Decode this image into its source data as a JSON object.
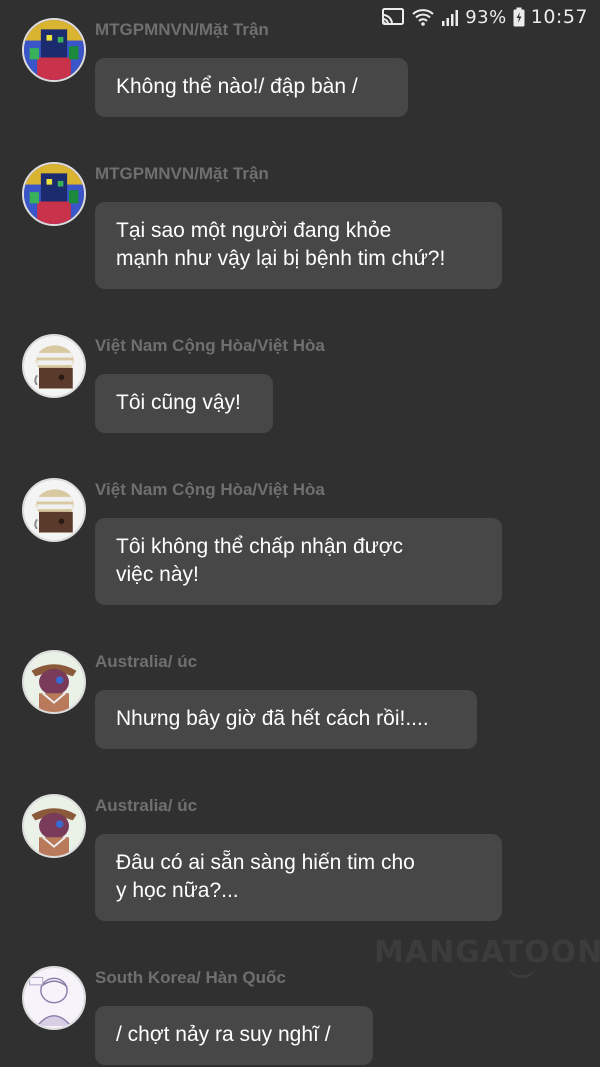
{
  "status_bar": {
    "cast_icon": "screen-cast-icon",
    "wifi_icon": "wifi-icon",
    "signal_icon": "signal-icon",
    "battery_percent": "93%",
    "battery_icon": "battery-charging-icon",
    "time": "10:57"
  },
  "messages": [
    {
      "sender": "MTGPMNVN/Mặt Trận",
      "avatar": "mtgpmnvn-avatar",
      "text": "Không thể nào!/ đập bàn /"
    },
    {
      "sender": "MTGPMNVN/Mặt Trận",
      "avatar": "mtgpmnvn-avatar",
      "text_lines": [
        "Tại sao một người đang khỏe",
        "mạnh như vậy lại bị bệnh tim chứ?!"
      ]
    },
    {
      "sender": "Việt Nam Cộng Hòa/Việt Hòa",
      "avatar": "vnch-avatar",
      "text": "Tôi cũng vậy!"
    },
    {
      "sender": "Việt Nam Cộng Hòa/Việt Hòa",
      "avatar": "vnch-avatar",
      "text_lines": [
        "Tôi không thể chấp nhận được",
        "việc này!"
      ]
    },
    {
      "sender": "Australia/ úc",
      "avatar": "australia-avatar",
      "text": "Nhưng bây giờ đã hết cách rồi!...."
    },
    {
      "sender": "Australia/ úc",
      "avatar": "australia-avatar",
      "text_lines": [
        "Đâu có ai sẵn sàng hiến tim cho",
        "y học nữa?..."
      ]
    },
    {
      "sender": "South Korea/ Hàn Quốc",
      "avatar": "south-korea-avatar",
      "text": "/ chợt nảy ra suy nghĩ /"
    }
  ],
  "watermark": "MANGATOON",
  "colors": {
    "background": "#303030",
    "bubble": "#474747",
    "sender_text": "#6f6f6f",
    "message_text": "#ffffff"
  }
}
